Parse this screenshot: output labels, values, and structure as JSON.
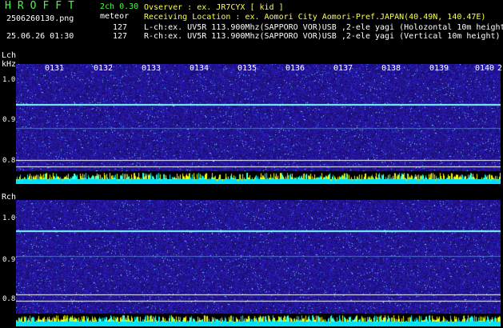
{
  "header": {
    "app_title": "HROFFT",
    "version": "2ch 0.30",
    "filename": "2506260130.png",
    "mode": "meteor",
    "datetime": "25.06.26 01:30",
    "count_l": "127",
    "count_r": "127"
  },
  "info": {
    "observer": "Ovserver          : ex. JR7CYX [ kid ]",
    "location": "Receiving Location : ex. Aomori City Aomori-Pref.JAPAN(40.49N, 140.47E)",
    "lch": "L-ch:ex. UV5R 113.900Mhz(SAPPORO VOR)USB ,2-ele yagi (Holozontal 10m height",
    "rch": "R-ch:ex. UV5R 113.900Mhz(SAPPORO VOR)USB ,2-ele yagi (Vertical 10m height)"
  },
  "channels": {
    "left": {
      "label": "Lch",
      "unit": "kHz",
      "ticks": [
        "1.0",
        "0.9",
        "0.8"
      ]
    },
    "right": {
      "label": "Rch",
      "ticks": [
        "1.0",
        "0.9",
        "0.8"
      ]
    }
  },
  "time_ticks": [
    "0131",
    "0132",
    "0133",
    "0134",
    "0135",
    "0136",
    "0137",
    "0138",
    "0139",
    "0140",
    "2"
  ],
  "colors": {
    "background": "#000000",
    "text_green": "#3cff3c",
    "text_white": "#ffffff",
    "text_yellow": "#ffff40",
    "waterfall_blue": "#1a1ab4",
    "carrier_line": "#7fffff",
    "level_yellow": "#ffff00",
    "level_cyan": "#00ffff"
  }
}
